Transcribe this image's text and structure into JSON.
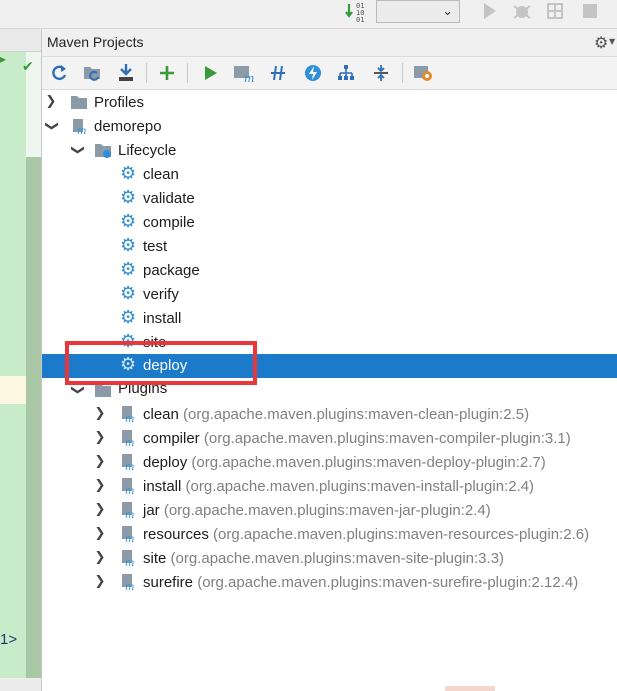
{
  "panel": {
    "title": "Maven Projects"
  },
  "editor": {
    "line_number": "1"
  },
  "tree": {
    "profiles": "Profiles",
    "project": "demorepo",
    "lifecycle": {
      "label": "Lifecycle",
      "phases": [
        "clean",
        "validate",
        "compile",
        "test",
        "package",
        "verify",
        "install",
        "site",
        "deploy"
      ],
      "selected": "deploy"
    },
    "plugins": {
      "label": "Plugins",
      "items": [
        {
          "name": "clean",
          "coord": "(org.apache.maven.plugins:maven-clean-plugin:2.5)"
        },
        {
          "name": "compiler",
          "coord": "(org.apache.maven.plugins:maven-compiler-plugin:3.1)"
        },
        {
          "name": "deploy",
          "coord": "(org.apache.maven.plugins:maven-deploy-plugin:2.7)"
        },
        {
          "name": "install",
          "coord": "(org.apache.maven.plugins:maven-install-plugin:2.4)"
        },
        {
          "name": "jar",
          "coord": "(org.apache.maven.plugins:maven-jar-plugin:2.4)"
        },
        {
          "name": "resources",
          "coord": "(org.apache.maven.plugins:maven-resources-plugin:2.6)"
        },
        {
          "name": "site",
          "coord": "(org.apache.maven.plugins:maven-site-plugin:3.3)"
        },
        {
          "name": "surefire",
          "coord": "(org.apache.maven.plugins:maven-surefire-plugin:2.12.4)"
        }
      ]
    }
  },
  "icons": {
    "toolbar": [
      "reimport-icon",
      "generate-sources-icon",
      "download-icon",
      "add-icon",
      "run-icon",
      "execute-goal-icon",
      "toggle-offline-icon",
      "skip-tests-icon",
      "show-dependencies-icon",
      "collapse-all-icon",
      "settings-icon"
    ]
  },
  "colors": {
    "selection": "#1b7ac9",
    "highlight_box": "#e8363b",
    "gear_blue": "#2f8fd8"
  }
}
